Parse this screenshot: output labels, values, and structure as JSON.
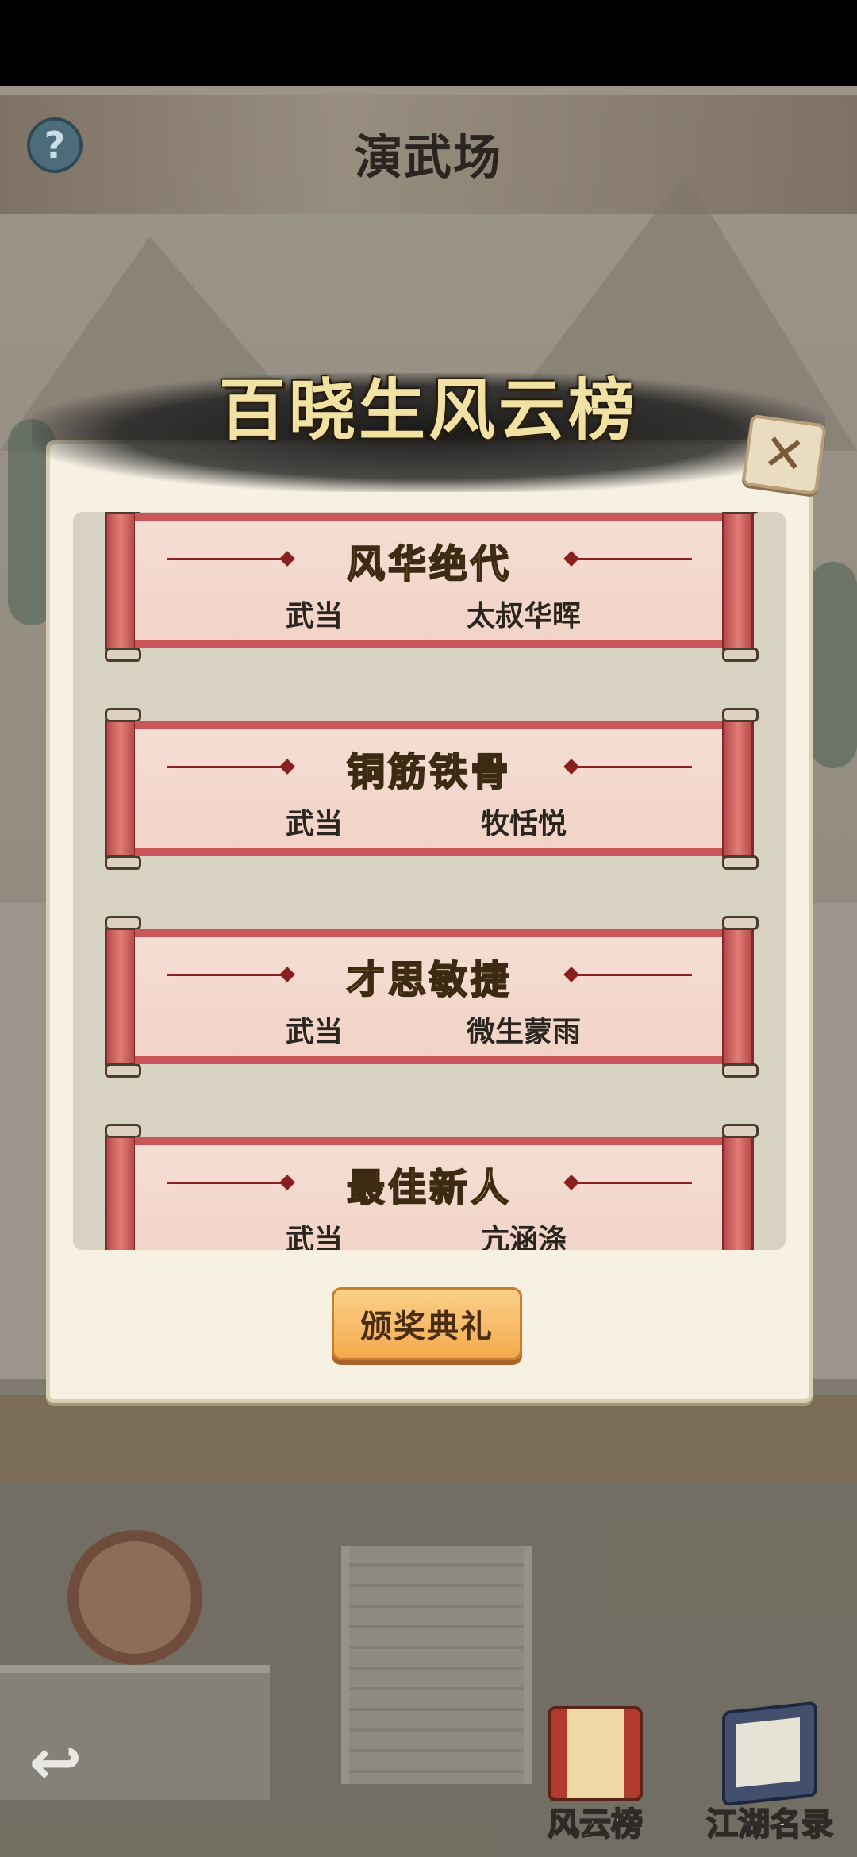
{
  "header": {
    "title": "演武场",
    "help_icon": "?"
  },
  "modal": {
    "title": "百晓生风云榜",
    "close_icon": "✕",
    "awards": [
      {
        "title": "风华绝代",
        "sect": "武当",
        "winner": "太叔华晖"
      },
      {
        "title": "铜筋铁骨",
        "sect": "武当",
        "winner": "牧恬悦"
      },
      {
        "title": "才思敏捷",
        "sect": "武当",
        "winner": "微生蒙雨"
      },
      {
        "title": "最佳新人",
        "sect": "武当",
        "winner": "亢涵涤"
      }
    ],
    "ceremony_button": "颁奖典礼"
  },
  "bottom_nav": {
    "back_icon": "↩",
    "items": [
      {
        "label": "风云榜",
        "icon": "scroll-icon"
      },
      {
        "label": "江湖名录",
        "icon": "book-icon"
      }
    ]
  },
  "colors": {
    "button_orange": "#f3a94c",
    "scroll_red": "#c9565a",
    "title_gold": "#f1e2a3"
  }
}
